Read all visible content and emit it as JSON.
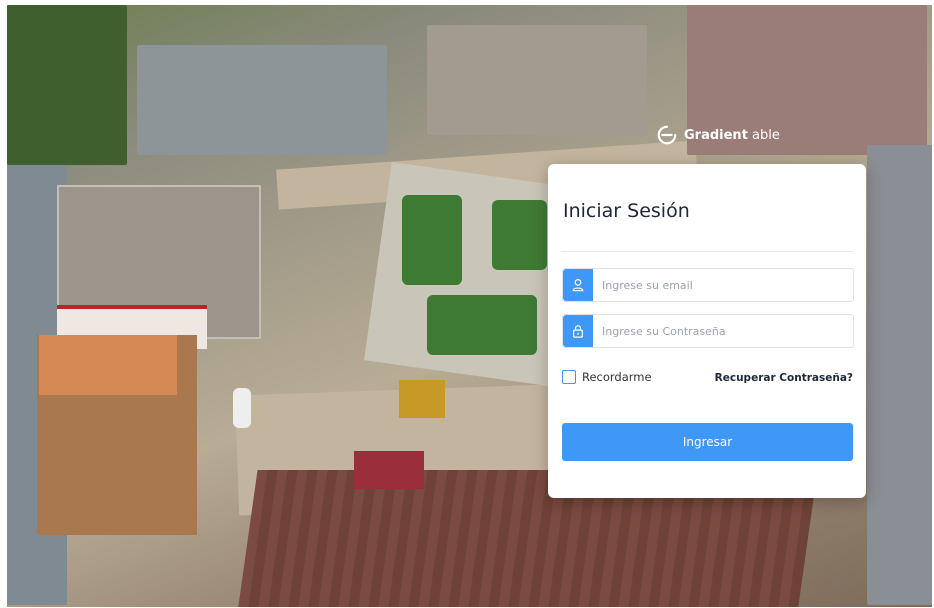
{
  "brand": {
    "name_bold": "Gradient",
    "name_light": " able",
    "icon": "gradient-logo-icon"
  },
  "login": {
    "title": "Iniciar Sesión",
    "email": {
      "placeholder": "Ingrese su email",
      "value": "",
      "icon": "user-icon"
    },
    "password": {
      "placeholder": "Ingrese su Contraseña",
      "value": "",
      "icon": "lock-icon"
    },
    "remember_label": "Recordarme",
    "remember_checked": false,
    "recover_label": "Recuperar Contraseña?",
    "submit_label": "Ingresar"
  },
  "colors": {
    "accent": "#3f97f6",
    "title_text": "#1d2738",
    "card_bg": "#ffffff"
  }
}
